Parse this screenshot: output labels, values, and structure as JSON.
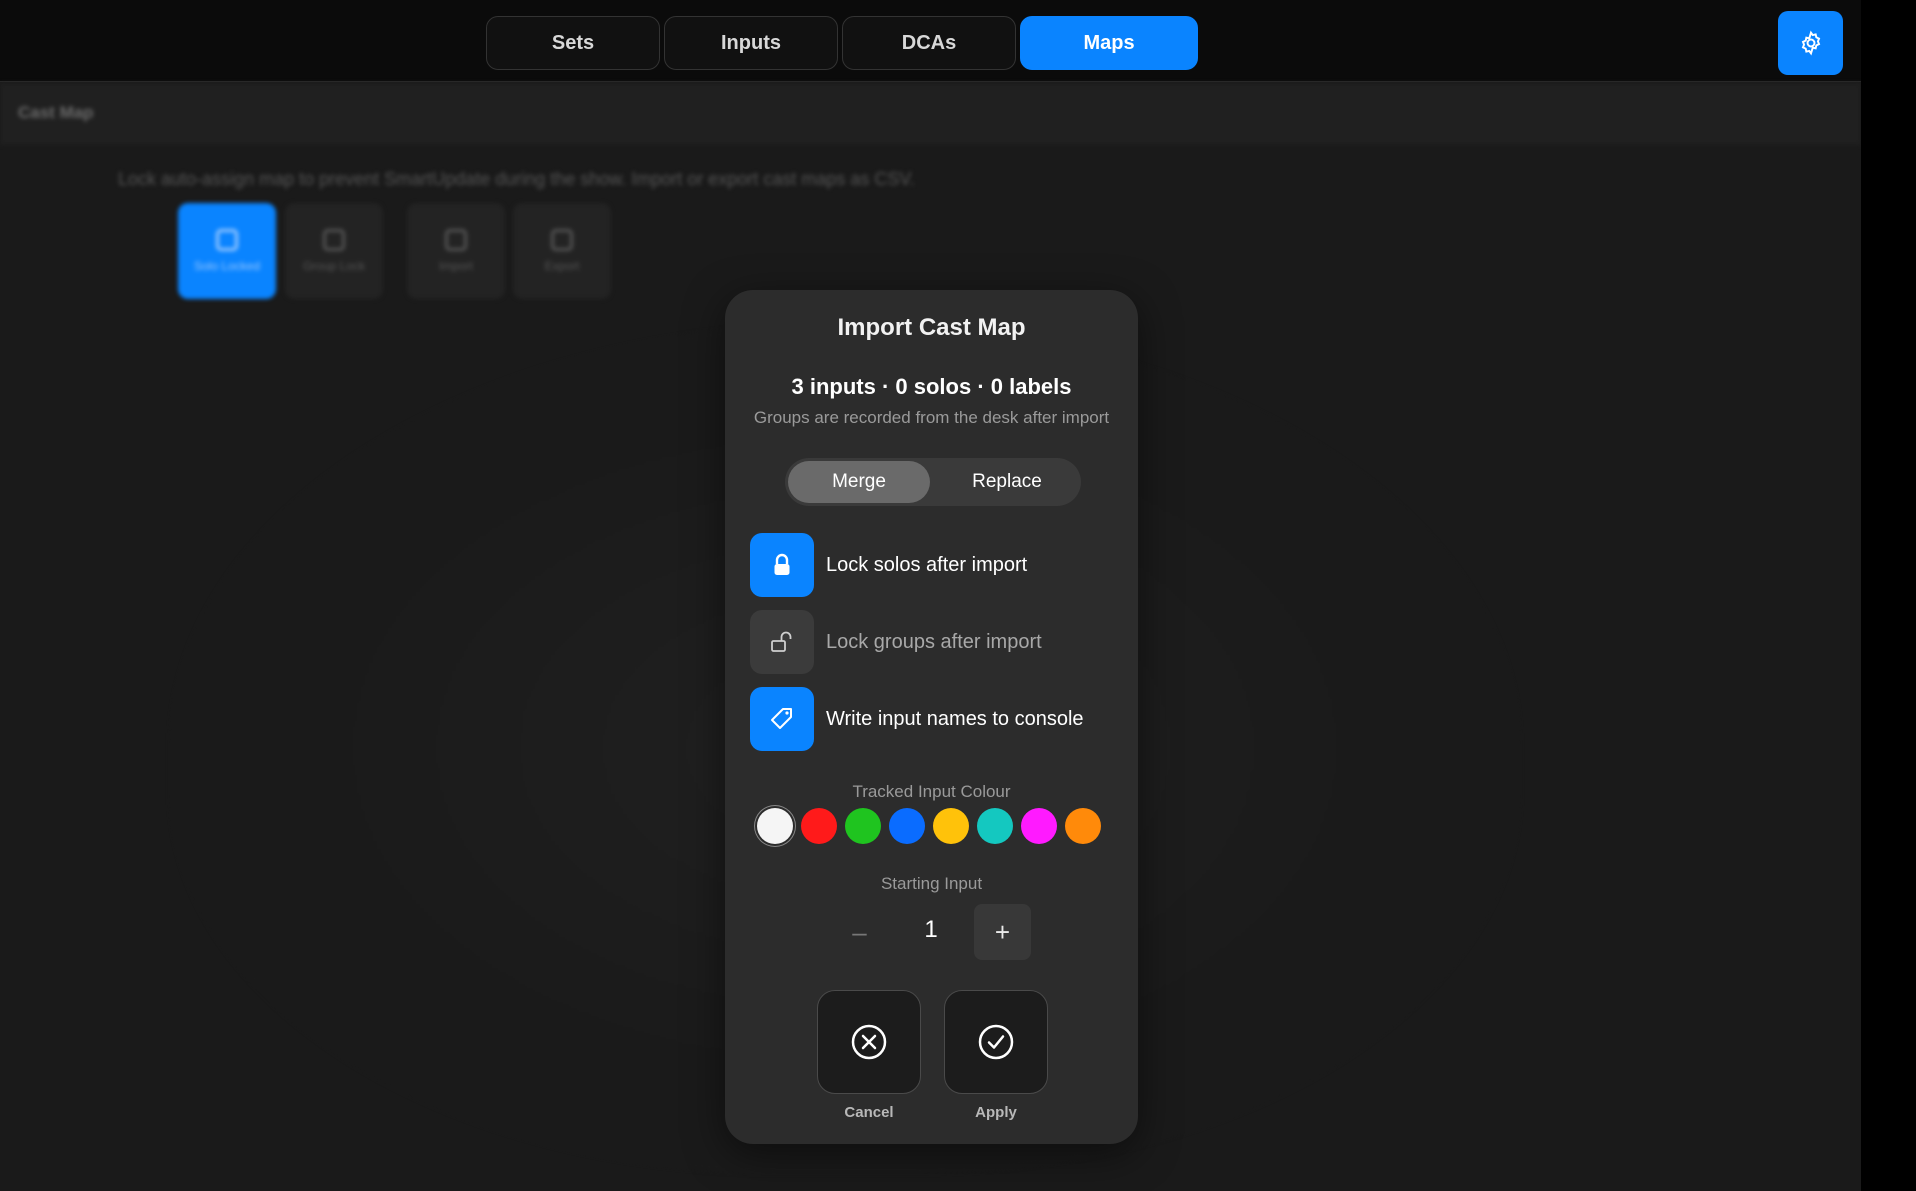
{
  "nav": {
    "tabs": [
      {
        "label": "Sets",
        "active": false
      },
      {
        "label": "Inputs",
        "active": false
      },
      {
        "label": "DCAs",
        "active": false
      },
      {
        "label": "Maps",
        "active": true
      }
    ],
    "settings_icon": "gear-icon"
  },
  "background": {
    "section_title": "Cast Map",
    "help_text": "Lock auto-assign map to prevent SmartUpdate during the show. Import or export cast maps as CSV.",
    "buttons": [
      {
        "label": "Solo Locked",
        "icon": "lock-icon",
        "active": true
      },
      {
        "label": "Group Lock",
        "icon": "unlock-icon",
        "active": false
      },
      {
        "label": "Import",
        "icon": "import-icon",
        "active": false
      },
      {
        "label": "Export",
        "icon": "export-icon",
        "active": false
      }
    ]
  },
  "dialog": {
    "title": "Import Cast Map",
    "summary": "3 inputs · 0 solos · 0 labels",
    "subtitle": "Groups are recorded from the desk after import",
    "mode": {
      "options": [
        "Merge",
        "Replace"
      ],
      "selected": "Merge"
    },
    "options": [
      {
        "label": "Lock solos after import",
        "icon": "lock-icon",
        "enabled": true
      },
      {
        "label": "Lock groups after import",
        "icon": "unlock-icon",
        "enabled": false
      },
      {
        "label": "Write input names to console",
        "icon": "tag-icon",
        "enabled": true
      }
    ],
    "colour_label": "Tracked Input Colour",
    "colours": [
      "#f5f5f5",
      "#ff1a1a",
      "#1fc41f",
      "#0a6cff",
      "#ffc20a",
      "#14c8c0",
      "#ff1aff",
      "#ff8a0a"
    ],
    "selected_colour": "#f5f5f5",
    "starting_input_label": "Starting Input",
    "starting_input_value": "1",
    "minus": "–",
    "plus": "+",
    "cancel_label": "Cancel",
    "apply_label": "Apply"
  }
}
